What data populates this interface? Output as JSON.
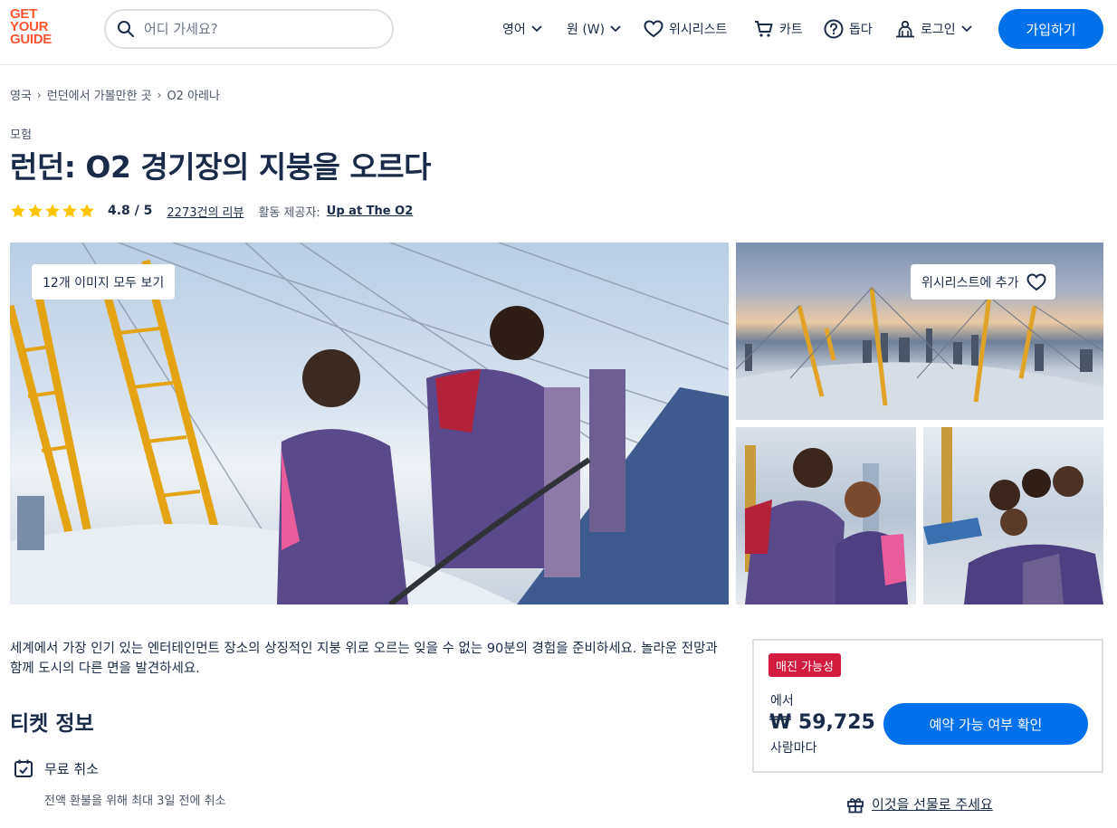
{
  "brand": {
    "logo_lines": [
      "GET",
      "YOUR",
      "GUIDE"
    ],
    "color": "#ff5533"
  },
  "header": {
    "search_placeholder": "어디 가세요?",
    "language": "영어",
    "currency": "원 (W)",
    "wishlist": "위시리스트",
    "cart": "카트",
    "help": "돕다",
    "login": "로그인",
    "signup": "가입하기"
  },
  "breadcrumb": [
    "영국",
    "런던에서 가볼만한 곳",
    "O2 아레나"
  ],
  "activity": {
    "category": "모험",
    "title": "런던: O2 경기장의 지붕을 오르다",
    "rating": "4.8 / 5",
    "stars": 5,
    "reviews": "2273건의 리뷰",
    "provider_label": "활동 제공자:",
    "provider": "Up at The O2"
  },
  "gallery": {
    "see_all": "12개 이미지 모두 보기",
    "add_wishlist": "위시리스트에 추가"
  },
  "description": "세계에서 가장 인기 있는 엔터테인먼트 장소의 상징적인 지붕 위로 오르는 잊을 수 없는 90분의 경험을 준비하세요. 놀라운 전망과 함께 도시의 다른 면을 발견하세요.",
  "ticket_info": {
    "heading": "티켓 정보",
    "feature_title": "무료 취소",
    "feature_sub": "전액 환불을 위해 최대 3일 전에 취소"
  },
  "booking": {
    "badge": "매진 가능성",
    "from": "에서",
    "price": "₩ 59,725",
    "per_person": "사람마다",
    "check_button": "예약 가능 여부 확인",
    "gift": "이것을 선물로 주세요"
  },
  "colors": {
    "primary": "#0071eb",
    "badge": "#d31b3f",
    "star": "#fdc500",
    "text": "#1a2b49"
  }
}
